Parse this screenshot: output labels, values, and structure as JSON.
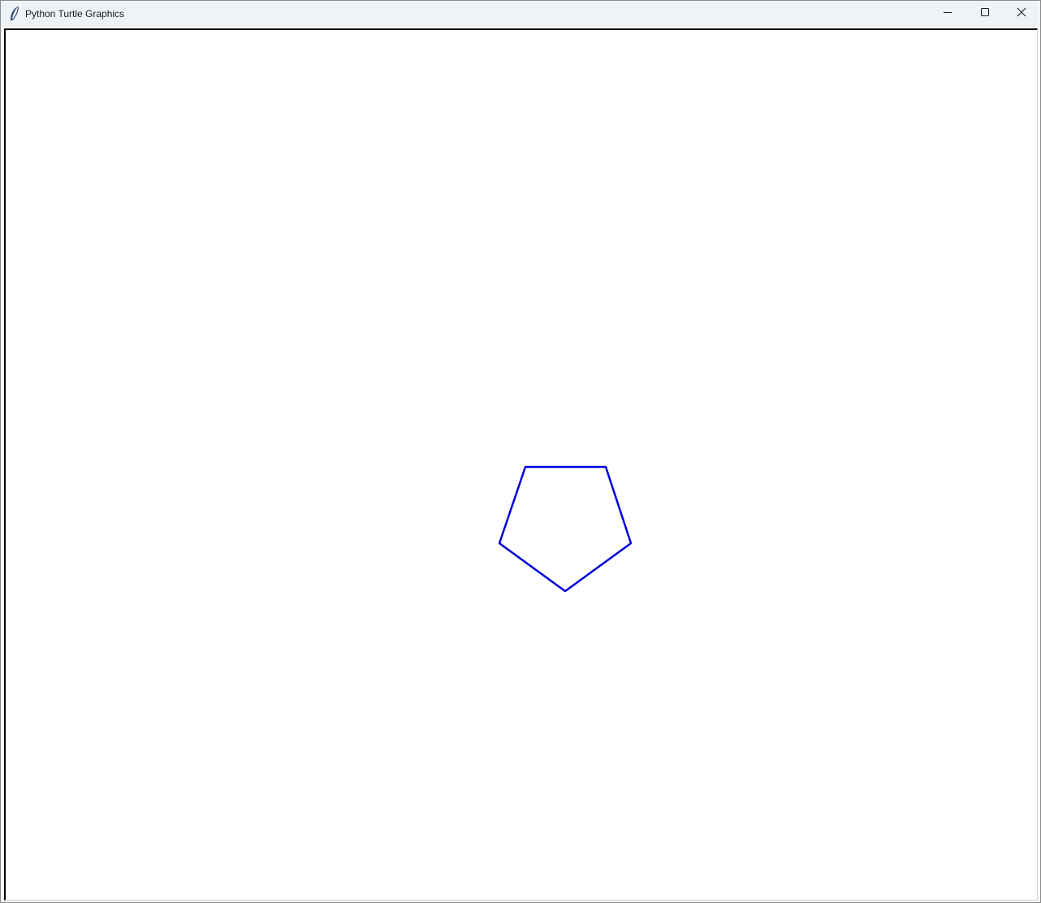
{
  "window": {
    "title": "Python Turtle Graphics",
    "app_icon": "feather-icon",
    "controls": {
      "minimize_icon": "minimize-icon",
      "maximize_icon": "maximize-icon",
      "close_icon": "close-icon"
    }
  },
  "canvas": {
    "background": "#ffffff",
    "shape": {
      "type": "pentagon",
      "stroke_color": "#0000dd",
      "fill": "none"
    }
  }
}
